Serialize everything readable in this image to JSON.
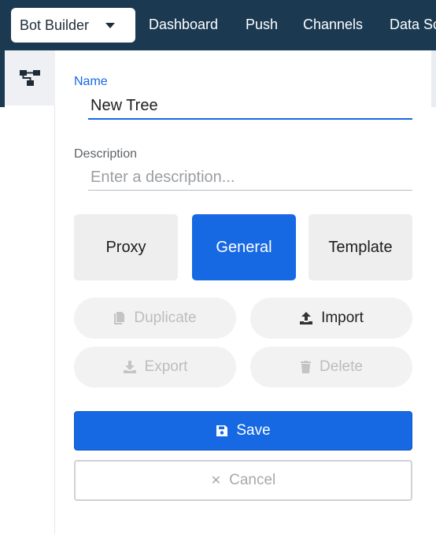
{
  "colors": {
    "topbar": "#1b3a52",
    "primary": "#1668e3",
    "button_gray": "#eeeeee",
    "disabled_text": "#bdbdbd"
  },
  "topbar": {
    "app_select": {
      "value": "Bot Builder",
      "icon": "chevron-down-icon"
    },
    "nav": [
      "Dashboard",
      "Push",
      "Channels",
      "Data Sc"
    ]
  },
  "sidebar": {
    "tree_icon": "tree-structure-icon"
  },
  "form": {
    "name": {
      "label": "Name",
      "value": "New Tree"
    },
    "description": {
      "label": "Description",
      "value": "",
      "placeholder": "Enter a description..."
    }
  },
  "types": [
    {
      "label": "Proxy",
      "selected": false
    },
    {
      "label": "General",
      "selected": true
    },
    {
      "label": "Template",
      "selected": false
    }
  ],
  "actions": {
    "duplicate": {
      "label": "Duplicate",
      "icon": "copy-icon",
      "enabled": false
    },
    "import": {
      "label": "Import",
      "icon": "upload-icon",
      "enabled": true
    },
    "export": {
      "label": "Export",
      "icon": "download-icon",
      "enabled": false
    },
    "delete": {
      "label": "Delete",
      "icon": "trash-icon",
      "enabled": false
    }
  },
  "save": {
    "label": "Save",
    "icon": "save-icon"
  },
  "cancel": {
    "label": "Cancel",
    "icon": "close-icon"
  }
}
